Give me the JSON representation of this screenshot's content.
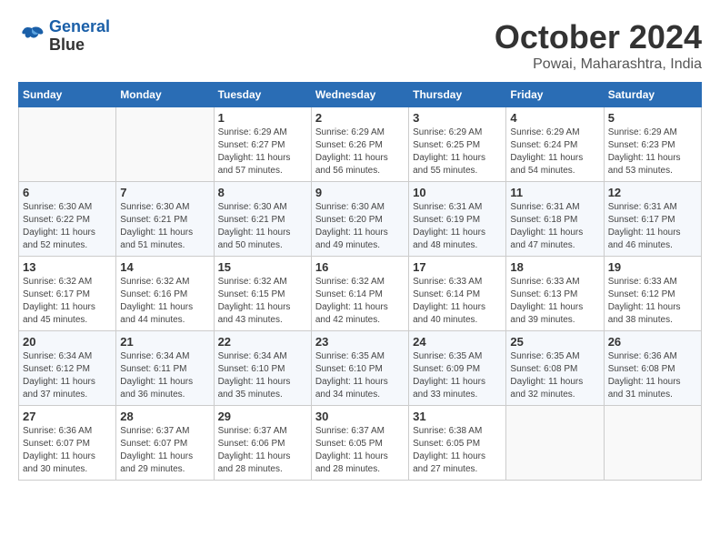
{
  "header": {
    "logo_line1": "General",
    "logo_line2": "Blue",
    "month": "October 2024",
    "location": "Powai, Maharashtra, India"
  },
  "weekdays": [
    "Sunday",
    "Monday",
    "Tuesday",
    "Wednesday",
    "Thursday",
    "Friday",
    "Saturday"
  ],
  "weeks": [
    [
      {
        "day": "",
        "info": ""
      },
      {
        "day": "",
        "info": ""
      },
      {
        "day": "1",
        "info": "Sunrise: 6:29 AM\nSunset: 6:27 PM\nDaylight: 11 hours and 57 minutes."
      },
      {
        "day": "2",
        "info": "Sunrise: 6:29 AM\nSunset: 6:26 PM\nDaylight: 11 hours and 56 minutes."
      },
      {
        "day": "3",
        "info": "Sunrise: 6:29 AM\nSunset: 6:25 PM\nDaylight: 11 hours and 55 minutes."
      },
      {
        "day": "4",
        "info": "Sunrise: 6:29 AM\nSunset: 6:24 PM\nDaylight: 11 hours and 54 minutes."
      },
      {
        "day": "5",
        "info": "Sunrise: 6:29 AM\nSunset: 6:23 PM\nDaylight: 11 hours and 53 minutes."
      }
    ],
    [
      {
        "day": "6",
        "info": "Sunrise: 6:30 AM\nSunset: 6:22 PM\nDaylight: 11 hours and 52 minutes."
      },
      {
        "day": "7",
        "info": "Sunrise: 6:30 AM\nSunset: 6:21 PM\nDaylight: 11 hours and 51 minutes."
      },
      {
        "day": "8",
        "info": "Sunrise: 6:30 AM\nSunset: 6:21 PM\nDaylight: 11 hours and 50 minutes."
      },
      {
        "day": "9",
        "info": "Sunrise: 6:30 AM\nSunset: 6:20 PM\nDaylight: 11 hours and 49 minutes."
      },
      {
        "day": "10",
        "info": "Sunrise: 6:31 AM\nSunset: 6:19 PM\nDaylight: 11 hours and 48 minutes."
      },
      {
        "day": "11",
        "info": "Sunrise: 6:31 AM\nSunset: 6:18 PM\nDaylight: 11 hours and 47 minutes."
      },
      {
        "day": "12",
        "info": "Sunrise: 6:31 AM\nSunset: 6:17 PM\nDaylight: 11 hours and 46 minutes."
      }
    ],
    [
      {
        "day": "13",
        "info": "Sunrise: 6:32 AM\nSunset: 6:17 PM\nDaylight: 11 hours and 45 minutes."
      },
      {
        "day": "14",
        "info": "Sunrise: 6:32 AM\nSunset: 6:16 PM\nDaylight: 11 hours and 44 minutes."
      },
      {
        "day": "15",
        "info": "Sunrise: 6:32 AM\nSunset: 6:15 PM\nDaylight: 11 hours and 43 minutes."
      },
      {
        "day": "16",
        "info": "Sunrise: 6:32 AM\nSunset: 6:14 PM\nDaylight: 11 hours and 42 minutes."
      },
      {
        "day": "17",
        "info": "Sunrise: 6:33 AM\nSunset: 6:14 PM\nDaylight: 11 hours and 40 minutes."
      },
      {
        "day": "18",
        "info": "Sunrise: 6:33 AM\nSunset: 6:13 PM\nDaylight: 11 hours and 39 minutes."
      },
      {
        "day": "19",
        "info": "Sunrise: 6:33 AM\nSunset: 6:12 PM\nDaylight: 11 hours and 38 minutes."
      }
    ],
    [
      {
        "day": "20",
        "info": "Sunrise: 6:34 AM\nSunset: 6:12 PM\nDaylight: 11 hours and 37 minutes."
      },
      {
        "day": "21",
        "info": "Sunrise: 6:34 AM\nSunset: 6:11 PM\nDaylight: 11 hours and 36 minutes."
      },
      {
        "day": "22",
        "info": "Sunrise: 6:34 AM\nSunset: 6:10 PM\nDaylight: 11 hours and 35 minutes."
      },
      {
        "day": "23",
        "info": "Sunrise: 6:35 AM\nSunset: 6:10 PM\nDaylight: 11 hours and 34 minutes."
      },
      {
        "day": "24",
        "info": "Sunrise: 6:35 AM\nSunset: 6:09 PM\nDaylight: 11 hours and 33 minutes."
      },
      {
        "day": "25",
        "info": "Sunrise: 6:35 AM\nSunset: 6:08 PM\nDaylight: 11 hours and 32 minutes."
      },
      {
        "day": "26",
        "info": "Sunrise: 6:36 AM\nSunset: 6:08 PM\nDaylight: 11 hours and 31 minutes."
      }
    ],
    [
      {
        "day": "27",
        "info": "Sunrise: 6:36 AM\nSunset: 6:07 PM\nDaylight: 11 hours and 30 minutes."
      },
      {
        "day": "28",
        "info": "Sunrise: 6:37 AM\nSunset: 6:07 PM\nDaylight: 11 hours and 29 minutes."
      },
      {
        "day": "29",
        "info": "Sunrise: 6:37 AM\nSunset: 6:06 PM\nDaylight: 11 hours and 28 minutes."
      },
      {
        "day": "30",
        "info": "Sunrise: 6:37 AM\nSunset: 6:05 PM\nDaylight: 11 hours and 28 minutes."
      },
      {
        "day": "31",
        "info": "Sunrise: 6:38 AM\nSunset: 6:05 PM\nDaylight: 11 hours and 27 minutes."
      },
      {
        "day": "",
        "info": ""
      },
      {
        "day": "",
        "info": ""
      }
    ]
  ]
}
